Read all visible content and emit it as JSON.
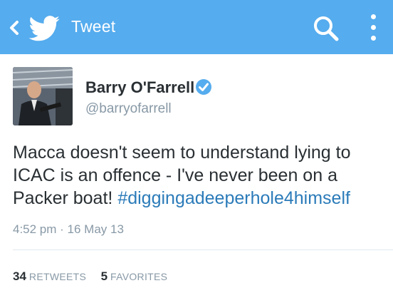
{
  "header": {
    "title": "Tweet",
    "back_icon": "chevron-left-icon",
    "logo_icon": "twitter-bird-icon",
    "search_icon": "search-icon",
    "menu_icon": "overflow-menu-icon",
    "bar_color": "#55acee"
  },
  "tweet": {
    "author_name": "Barry O'Farrell",
    "author_handle": "@barryofarrell",
    "verified": true,
    "text_before": "Macca doesn't seem to  understand lying to ICAC is an offence - I've never been on a Packer boat! ",
    "hashtag": "#diggingadeeperhole4himself",
    "timestamp": "4:52 pm · 16 May 13",
    "link_color": "#2b7bb9"
  },
  "stats": {
    "retweets_count": "34",
    "retweets_label": "RETWEETS",
    "favorites_count": "5",
    "favorites_label": "FAVORITES"
  }
}
